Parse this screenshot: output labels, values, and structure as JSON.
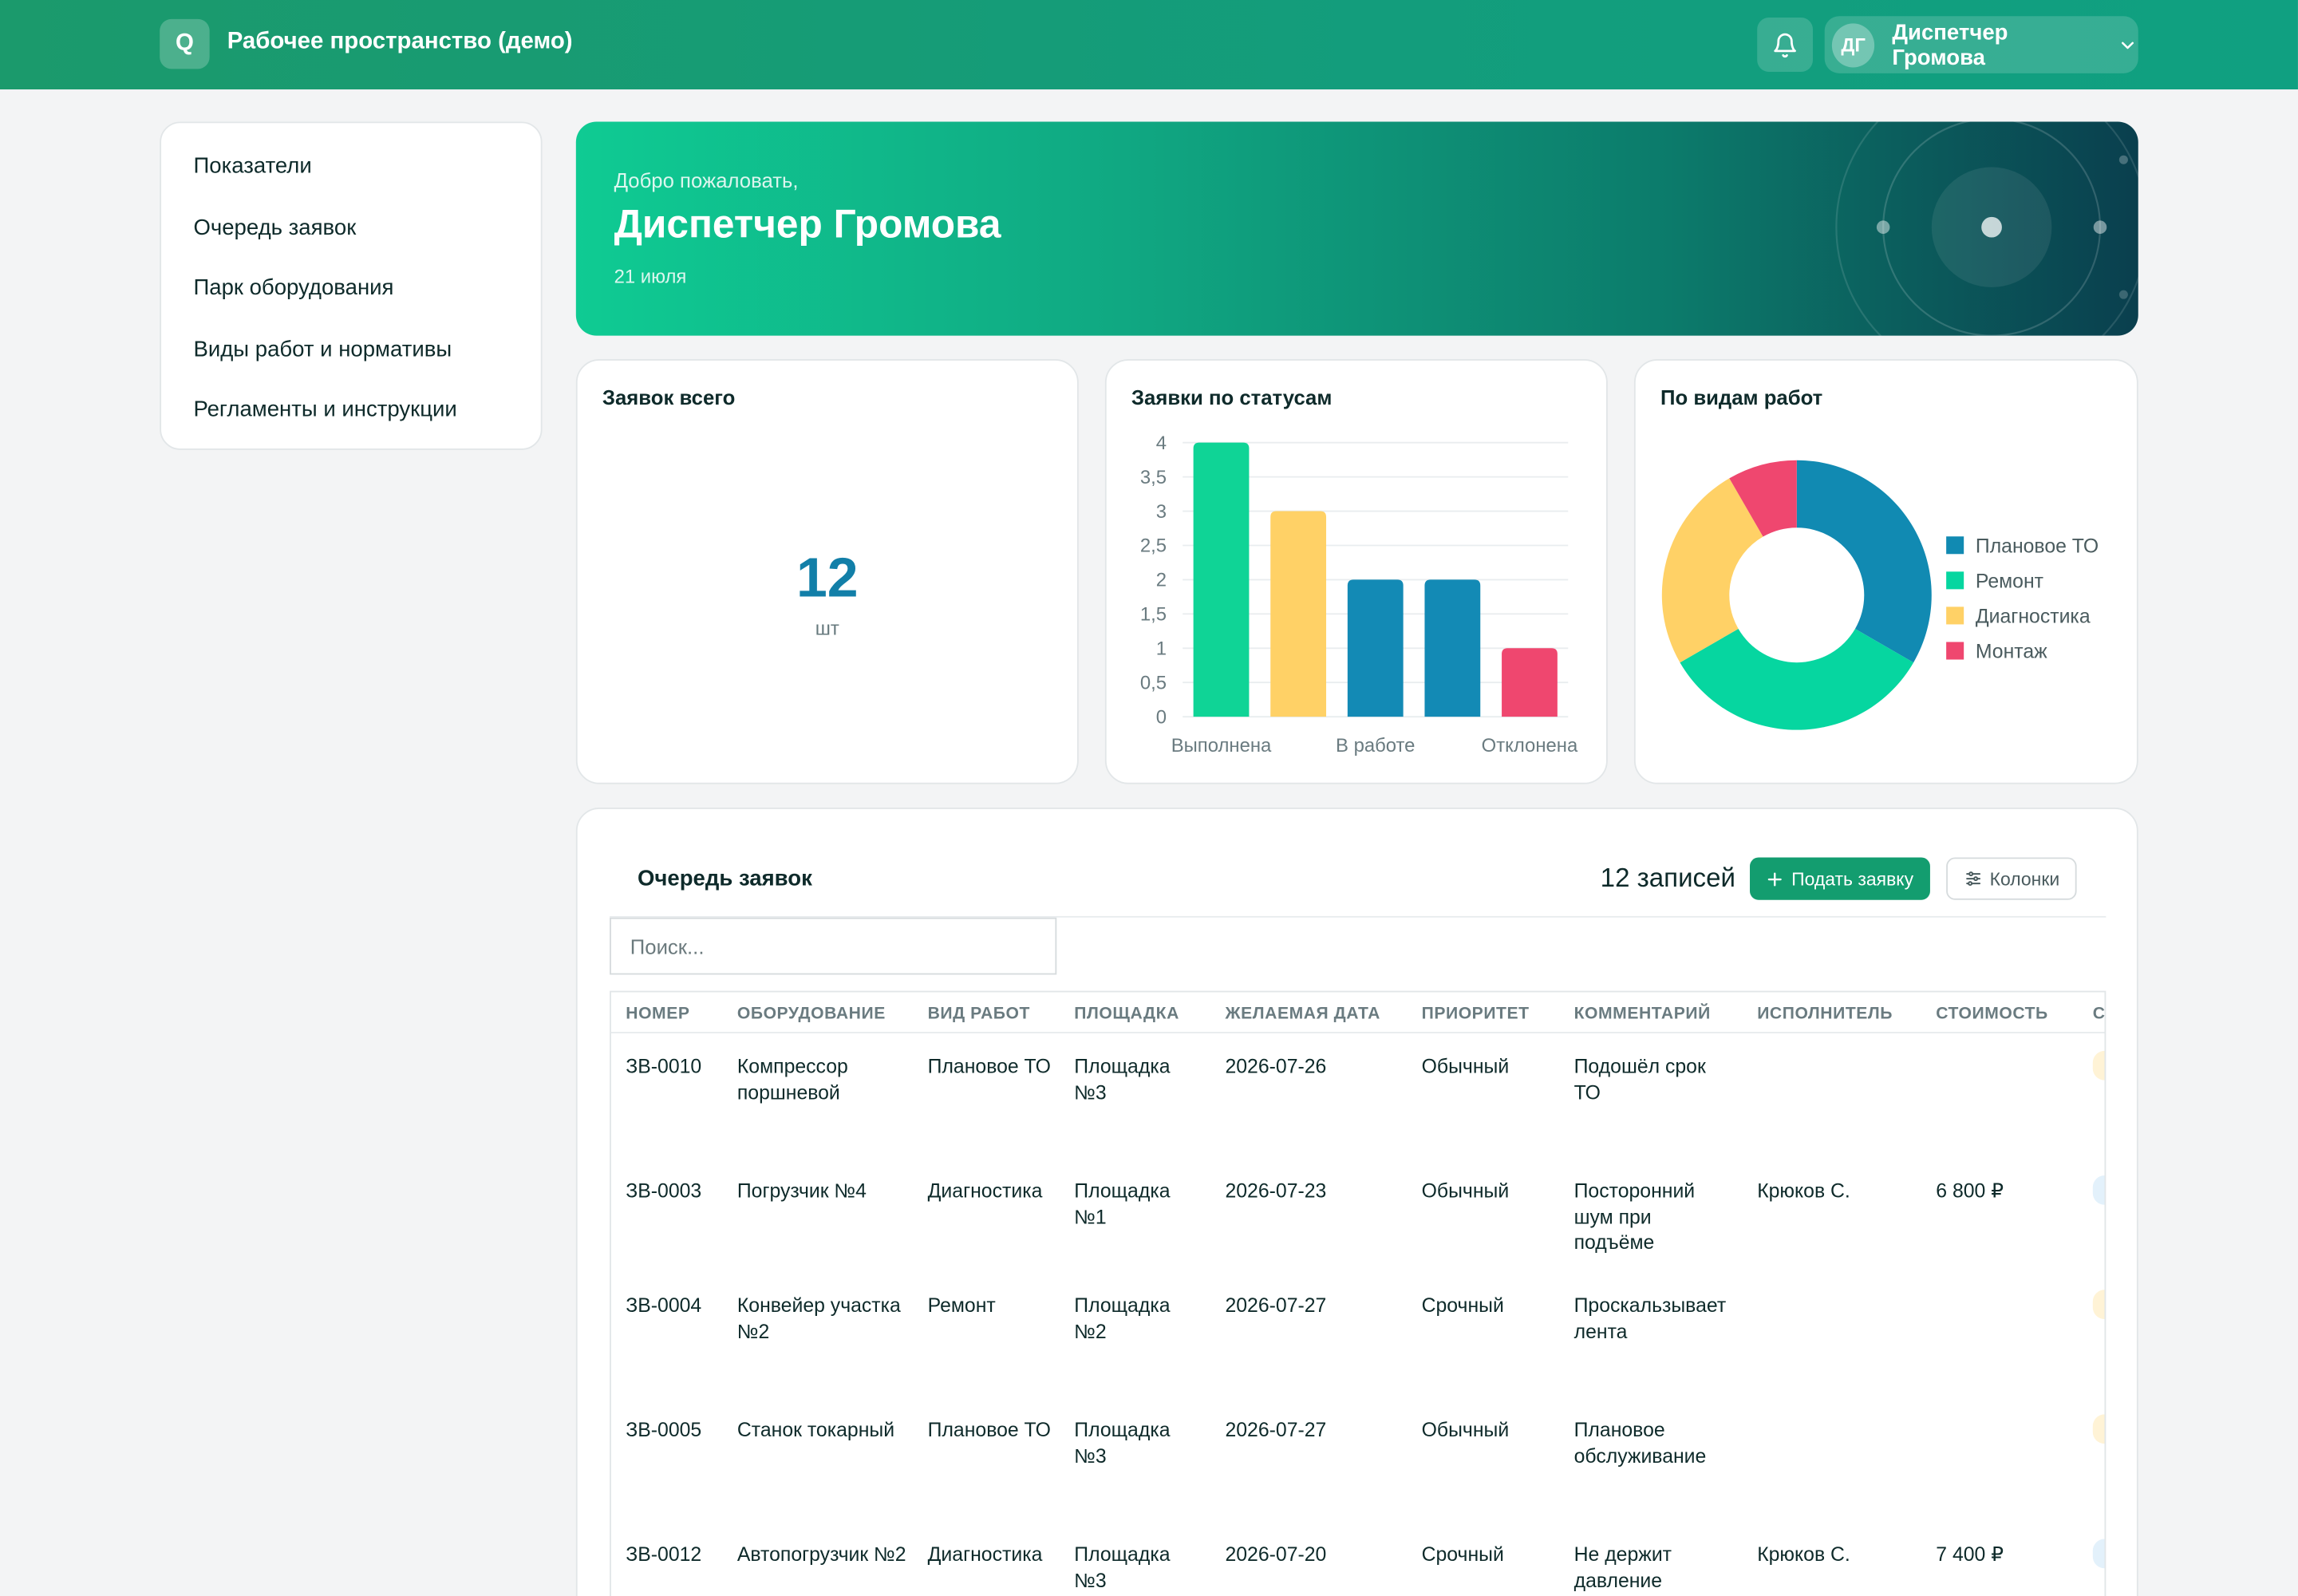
{
  "header": {
    "logo_letter": "Q",
    "title": "Рабочее пространство (демо)",
    "user_initials": "ДГ",
    "user_name": "Диспетчер Громова"
  },
  "sidebar": {
    "items": [
      {
        "label": "Показатели"
      },
      {
        "label": "Очередь заявок"
      },
      {
        "label": "Парк оборудования"
      },
      {
        "label": "Виды работ и нормативы"
      },
      {
        "label": "Регламенты и инструкции"
      }
    ]
  },
  "hero": {
    "welcome": "Добро пожаловать,",
    "name": "Диспетчер Громова",
    "date": "21 июля"
  },
  "cards": {
    "total": {
      "title": "Заявок всего",
      "value": "12",
      "unit": "шт"
    },
    "status": {
      "title": "Заявки по статусам"
    },
    "types": {
      "title": "По видам работ"
    }
  },
  "chart_data": [
    {
      "type": "bar",
      "title": "Заявки по статусам",
      "categories": [
        "Выполнена",
        "",
        "В работе",
        "",
        "Отклонена"
      ],
      "values": [
        4,
        3,
        2,
        2,
        1
      ],
      "colors": [
        "#0fd496",
        "#ffd166",
        "#138ab5",
        "#138ab5",
        "#ef476f"
      ],
      "xtick_labels": [
        "Выполнена",
        "В работе",
        "Отклонена"
      ],
      "yticks": [
        "0",
        "0,5",
        "1",
        "1,5",
        "2",
        "2,5",
        "3",
        "3,5",
        "4"
      ],
      "ylim": [
        0,
        4
      ],
      "grid": true
    },
    {
      "type": "pie",
      "title": "По видам работ",
      "labels": [
        "Плановое ТО",
        "Ремонт",
        "Диагностика",
        "Монтаж"
      ],
      "values": [
        4,
        4,
        3,
        1
      ],
      "colors": [
        "#118ab2",
        "#06d6a0",
        "#ffd166",
        "#ef476f"
      ],
      "donut": true,
      "legend": "right"
    }
  ],
  "queue": {
    "title": "Очередь заявок",
    "count": "12 записей",
    "add_label": "Подать заявку",
    "columns_label": "Колонки",
    "search_placeholder": "Поиск...",
    "headers": [
      "НОМЕР",
      "ОБОРУДОВАНИЕ",
      "ВИД РАБОТ",
      "ПЛОЩАДКА",
      "ЖЕЛАЕМАЯ ДАТА",
      "ПРИОРИТЕТ",
      "КОММЕНТАРИЙ",
      "ИСПОЛНИТЕЛЬ",
      "СТОИМОСТЬ",
      "С"
    ],
    "rows": [
      {
        "num": "ЗВ-0010",
        "equip": "Компрессор поршневой",
        "work": "Плановое ТО",
        "site": "Площадка №3",
        "date": "2026-07-26",
        "prio": "Обычный",
        "comment": "Подошёл срок ТО",
        "exec": "",
        "cost": "",
        "status_color": "#fff3d6"
      },
      {
        "num": "ЗВ-0003",
        "equip": "Погрузчик №4",
        "work": "Диагностика",
        "site": "Площадка №1",
        "date": "2026-07-23",
        "prio": "Обычный",
        "comment": "Посторонний шум при подъёме",
        "exec": "Крюков С.",
        "cost": "6 800 ₽",
        "status_color": "#e3f1fb"
      },
      {
        "num": "ЗВ-0004",
        "equip": "Конвейер участка №2",
        "work": "Ремонт",
        "site": "Площадка №2",
        "date": "2026-07-27",
        "prio": "Срочный",
        "comment": "Проскальзывает лента",
        "exec": "",
        "cost": "",
        "status_color": "#fff3d6"
      },
      {
        "num": "ЗВ-0005",
        "equip": "Станок токарный",
        "work": "Плановое ТО",
        "site": "Площадка №3",
        "date": "2026-07-27",
        "prio": "Обычный",
        "comment": "Плановое обслуживание",
        "exec": "",
        "cost": "",
        "status_color": "#fff3d6"
      },
      {
        "num": "ЗВ-0012",
        "equip": "Автопогрузчик №2",
        "work": "Диагностика",
        "site": "Площадка №3",
        "date": "2026-07-20",
        "prio": "Срочный",
        "comment": "Не держит давление",
        "exec": "Крюков С.",
        "cost": "7 400 ₽",
        "status_color": "#e3f1fb"
      }
    ]
  }
}
